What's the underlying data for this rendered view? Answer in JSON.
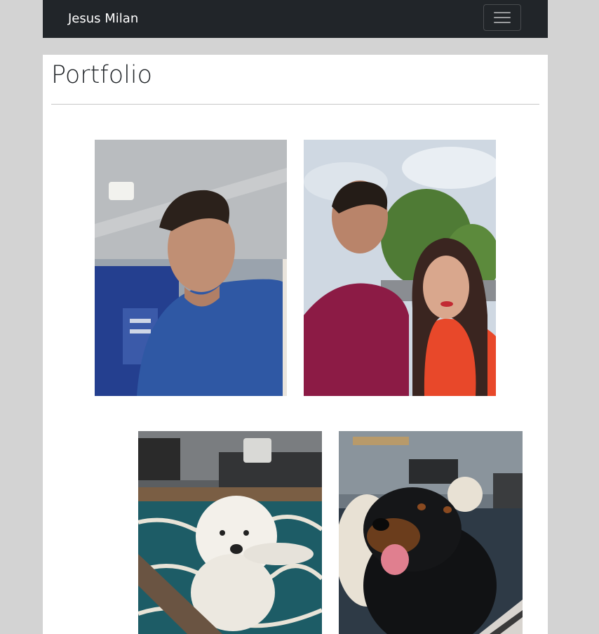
{
  "navbar": {
    "brand": "Jesus Milan",
    "toggle_icon": "hamburger-menu-icon"
  },
  "main": {
    "title": "Portfolio",
    "photos": [
      {
        "name": "portrait-man-blue-shirt",
        "alt": "man in blue shirt selfie"
      },
      {
        "name": "portrait-couple-outdoors",
        "alt": "couple selfie outdoors"
      },
      {
        "name": "white-dog-photo",
        "alt": "white fluffy dog on rug"
      },
      {
        "name": "rottweiler-photo",
        "alt": "rottweiler with tongue out"
      }
    ]
  },
  "colors": {
    "navbar_bg": "#212529",
    "page_bg": "#d3d3d3",
    "content_bg": "#ffffff"
  }
}
